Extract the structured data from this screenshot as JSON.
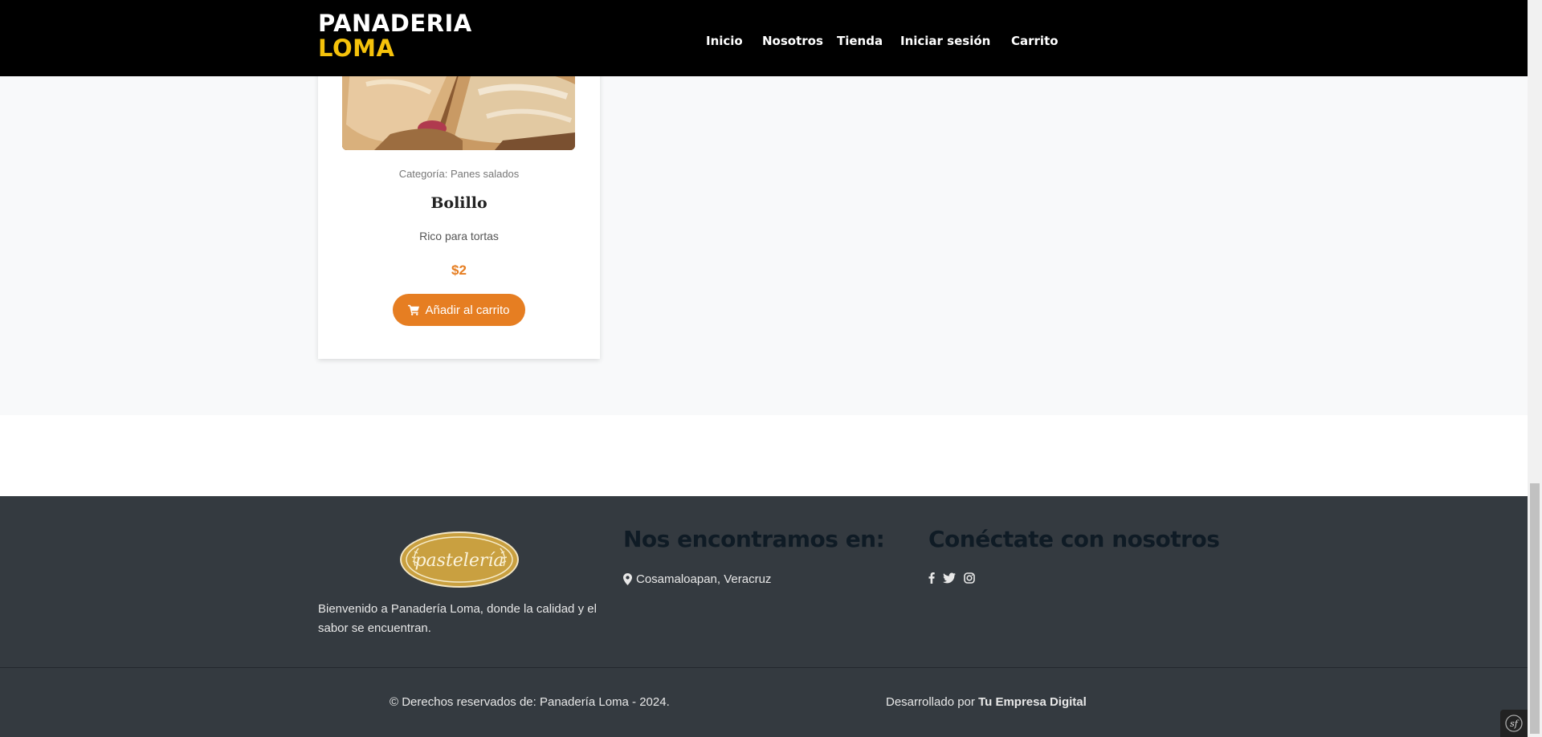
{
  "brand": {
    "line1": "PANADERIA",
    "line2": "LOMA"
  },
  "nav": {
    "items": [
      "Inicio",
      "Nosotros",
      "Tienda",
      "Iniciar sesión",
      "Carrito"
    ]
  },
  "product": {
    "category": "Categoría: Panes salados",
    "name": "Bolillo",
    "description": "Rico para tortas",
    "price": "$2",
    "button_label": "Añadir al carrito",
    "button_icon": "shopping-cart-icon"
  },
  "footer": {
    "logo_text": "pastelería",
    "description": "Bienvenido a Panadería Loma, donde la calidad y el sabor se encuentran.",
    "location_heading": "Nos encontramos en:",
    "location": "Cosamaloapan, Veracruz",
    "location_icon": "map-marker-icon",
    "social_heading": "Conéctate con nosotros",
    "social_icons": [
      "facebook-icon",
      "twitter-icon",
      "instagram-icon"
    ],
    "copyright": "© Derechos reservados de: Panadería Loma - 2024.",
    "developed_by_prefix": "Desarrollado por",
    "developed_by_name": "Tu Empresa Digital"
  },
  "colors": {
    "header_bg": "#000000",
    "brand_accent": "#f5c20b",
    "button": "#e67e22",
    "footer_bg": "#343a40",
    "footer_heading": "#0f1b25"
  }
}
